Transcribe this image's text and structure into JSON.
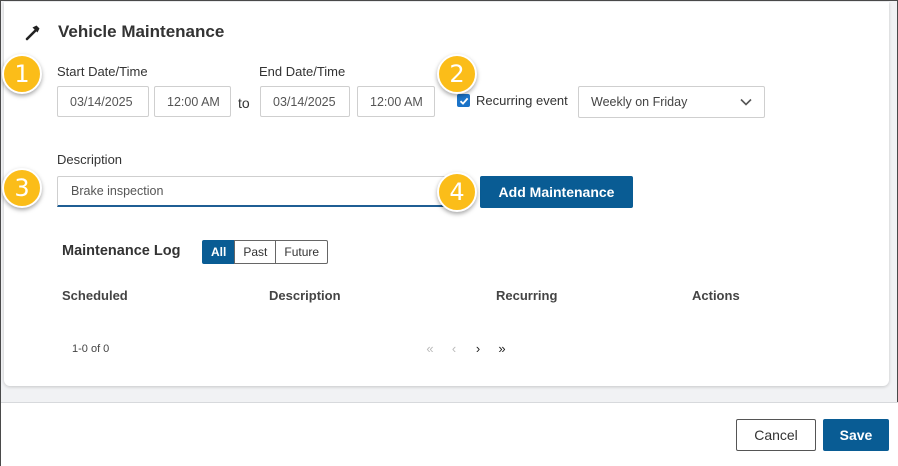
{
  "dialog": {
    "title": "Vehicle Maintenance",
    "icon": "hammer-icon"
  },
  "start": {
    "label": "Start Date/Time",
    "date": "03/14/2025",
    "time": "12:00 AM"
  },
  "separator": "to",
  "end": {
    "label": "End Date/Time",
    "date": "03/14/2025",
    "time": "12:00 AM"
  },
  "recurring": {
    "label": "Recurring event",
    "checked": true,
    "selected": "Weekly on Friday"
  },
  "description": {
    "label": "Description",
    "value": "Brake inspection"
  },
  "add_button": "Add Maintenance",
  "log": {
    "title": "Maintenance Log",
    "filters": [
      "All",
      "Past",
      "Future"
    ],
    "active_filter": "All",
    "columns": [
      "Scheduled",
      "Description",
      "Recurring",
      "Actions"
    ],
    "count": "1-0 of 0",
    "pager": {
      "first": "«",
      "prev": "‹",
      "next": "›",
      "last": "»"
    }
  },
  "callouts": [
    "1",
    "2",
    "3",
    "4"
  ],
  "footer": {
    "cancel": "Cancel",
    "save": "Save"
  },
  "colors": {
    "primary": "#095c94",
    "callout": "#fbbd19",
    "checkbox": "#1a73c8"
  }
}
